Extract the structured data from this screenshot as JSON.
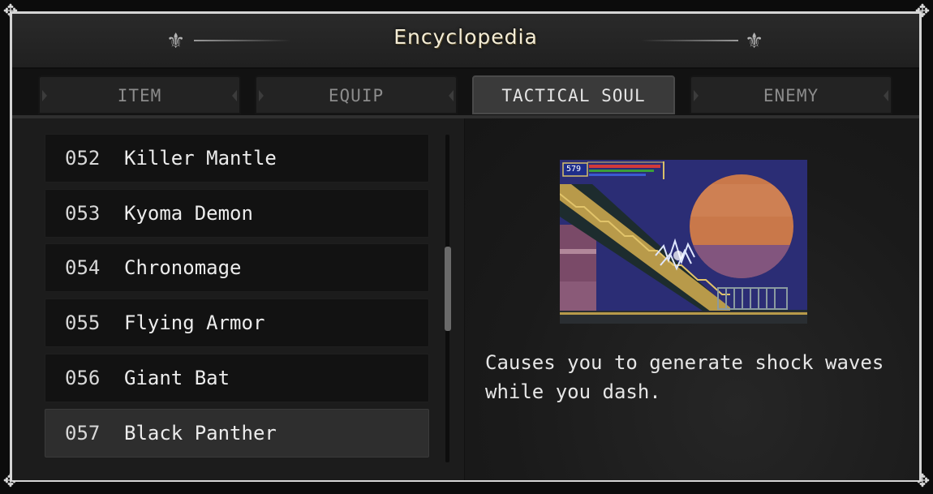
{
  "header": {
    "title": "Encyclopedia"
  },
  "tabs": [
    {
      "label": "ITEM",
      "active": false
    },
    {
      "label": "EQUIP",
      "active": false
    },
    {
      "label": "TACTICAL SOUL",
      "active": true
    },
    {
      "label": "ENEMY",
      "active": false
    }
  ],
  "list": {
    "items": [
      {
        "number": "052",
        "name": "Killer Mantle"
      },
      {
        "number": "053",
        "name": "Kyoma Demon"
      },
      {
        "number": "054",
        "name": "Chronomage"
      },
      {
        "number": "055",
        "name": "Flying Armor"
      },
      {
        "number": "056",
        "name": "Giant Bat"
      },
      {
        "number": "057",
        "name": "Black Panther"
      }
    ],
    "selected_index": 5
  },
  "detail": {
    "preview_hud_value": "579",
    "description": "Causes you to generate shock waves while you dash."
  },
  "colors": {
    "frame": "#d4d4d4",
    "panel": "#1c1c1c",
    "selected_row": "#2e2e2e",
    "title_text": "#f3ecd6",
    "preview_sky": "#2b2d75",
    "preview_moon": "#c9784a"
  }
}
